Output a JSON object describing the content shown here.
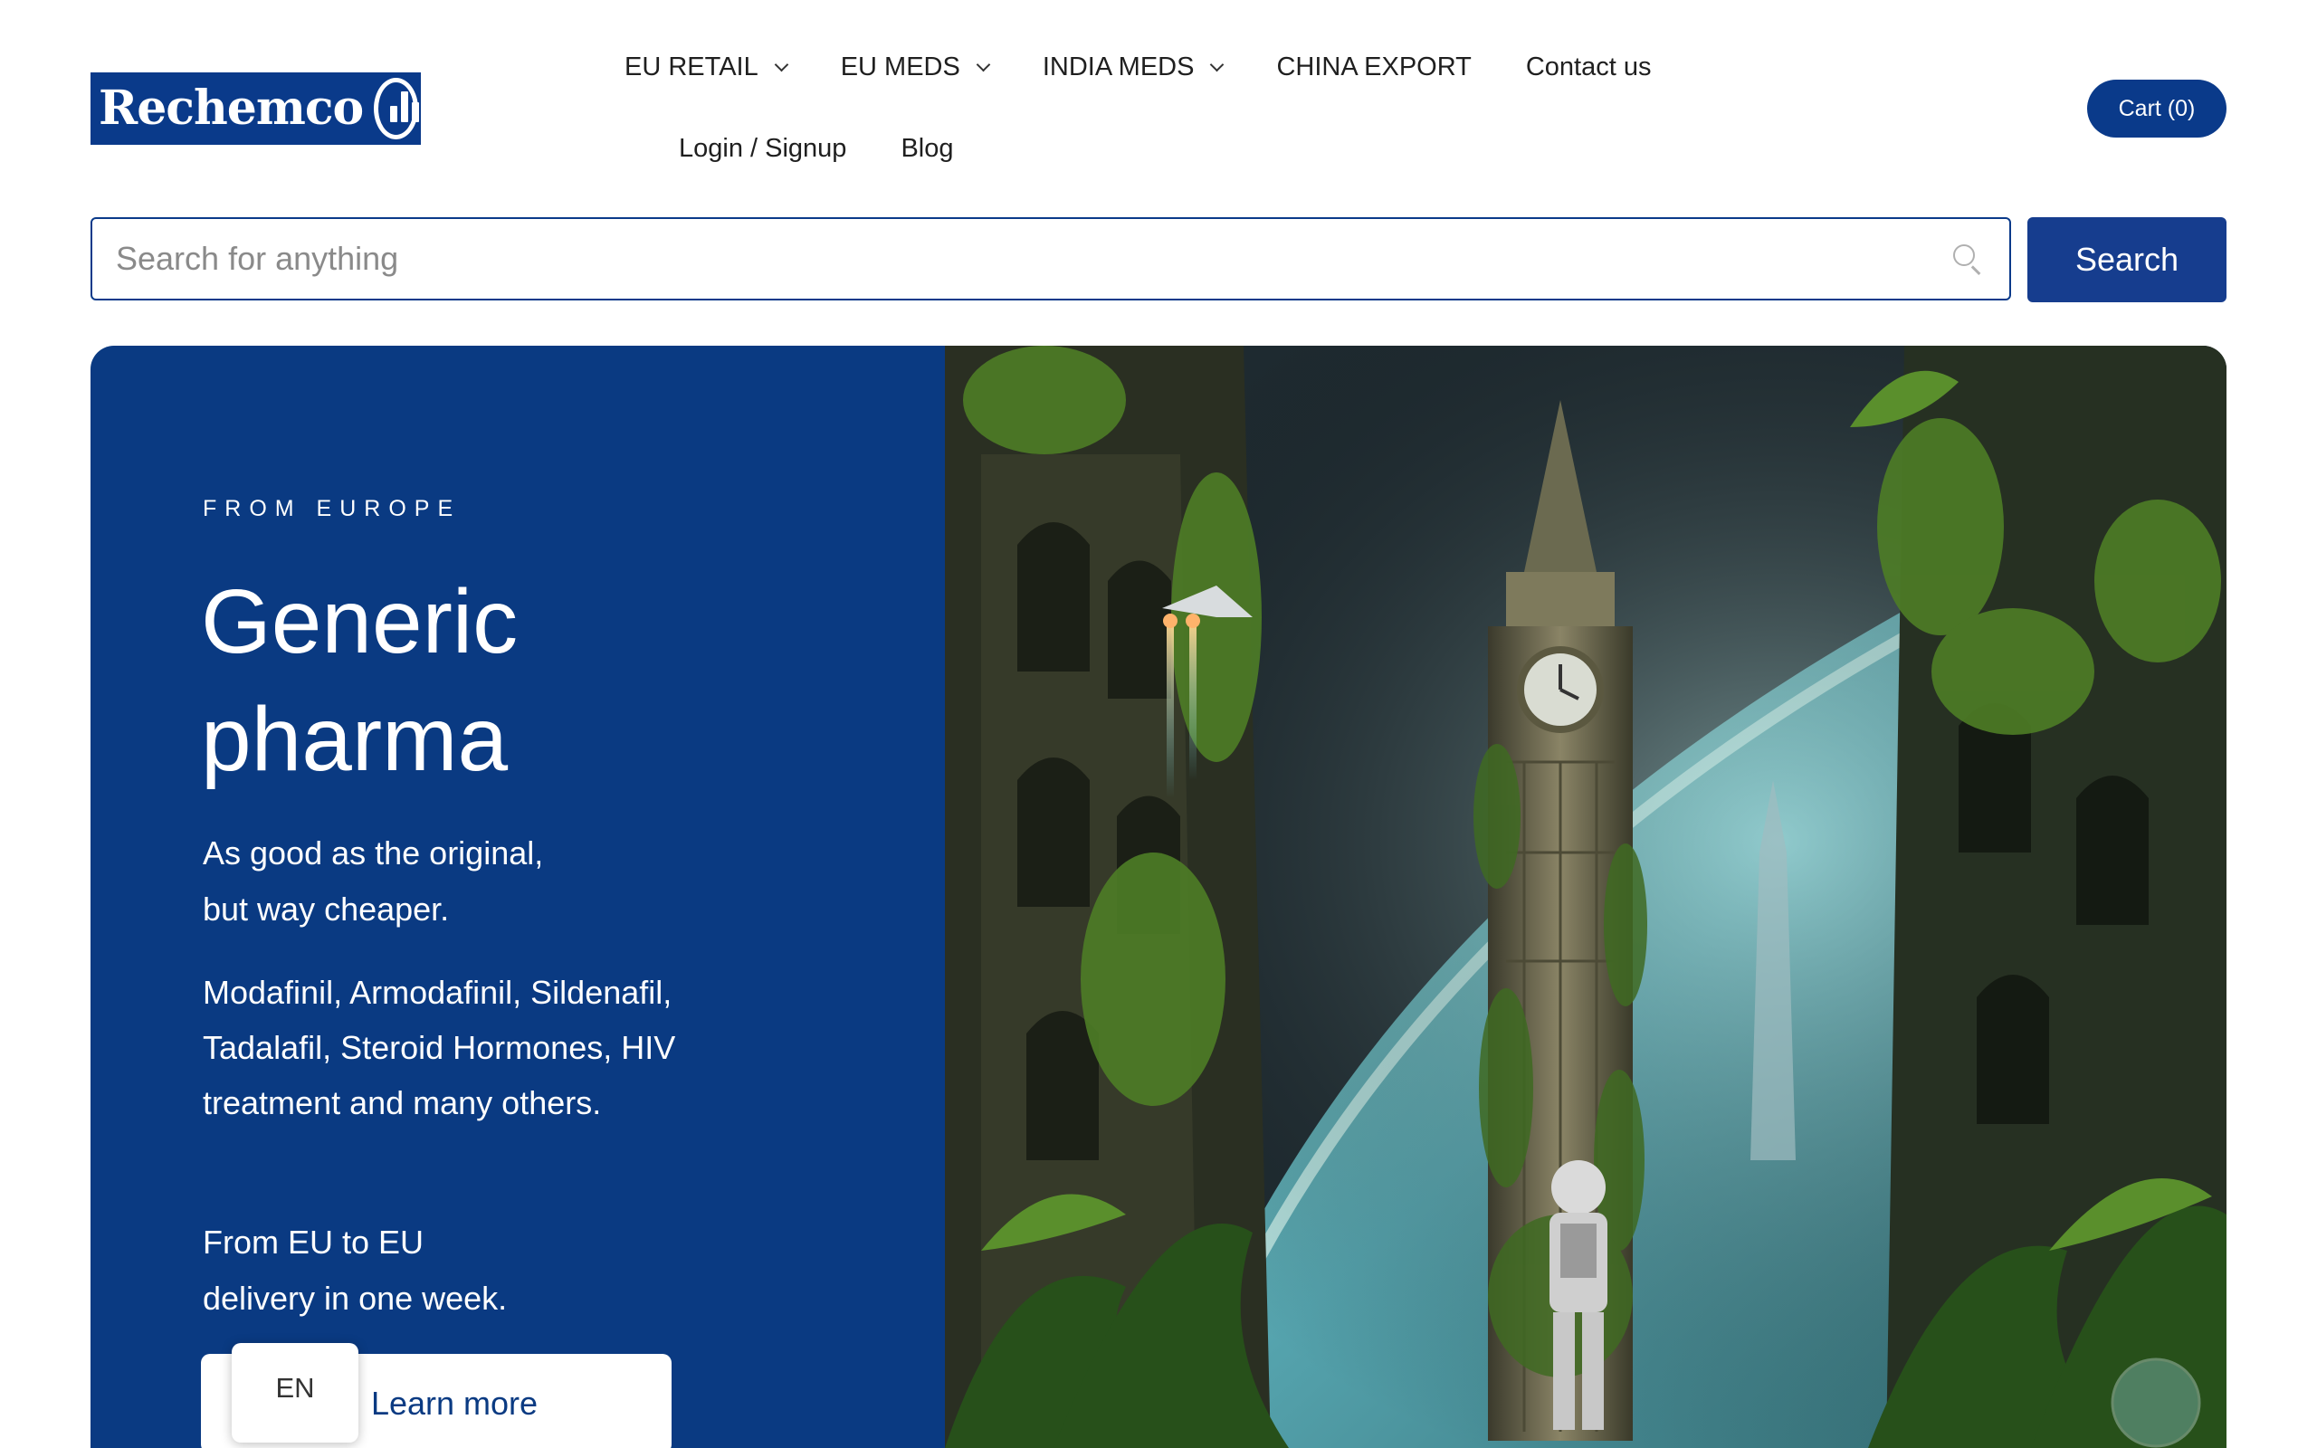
{
  "brand": {
    "name": "Rechemco"
  },
  "nav": {
    "row1": [
      {
        "label": "EU RETAIL",
        "dropdown": true
      },
      {
        "label": "EU MEDS",
        "dropdown": true
      },
      {
        "label": "INDIA MEDS",
        "dropdown": true
      },
      {
        "label": "CHINA EXPORT",
        "dropdown": false
      },
      {
        "label": "Contact us",
        "dropdown": false
      }
    ],
    "row2": [
      {
        "label": "Login / Signup"
      },
      {
        "label": "Blog"
      }
    ]
  },
  "cart": {
    "label": "Cart (0)"
  },
  "search": {
    "placeholder": "Search for anything",
    "button_label": "Search"
  },
  "hero": {
    "eyebrow": "FROM EUROPE",
    "headline_line1": "Generic",
    "headline_line2": "pharma",
    "tagline_line1": "As good as the original,",
    "tagline_line2": "but way cheaper.",
    "products_line1": "Modafinil, Armodafinil, Sildenafil,",
    "products_line2": "Tadalafil, Steroid Hormones, HIV",
    "products_line3": "treatment and many others.",
    "delivery_line1": "From EU to EU",
    "delivery_line2": "delivery in one week.",
    "cta_label": "Learn more"
  },
  "language": {
    "label": "EN"
  },
  "colors": {
    "brand_blue": "#0a3a82",
    "button_blue": "#163d8e"
  }
}
